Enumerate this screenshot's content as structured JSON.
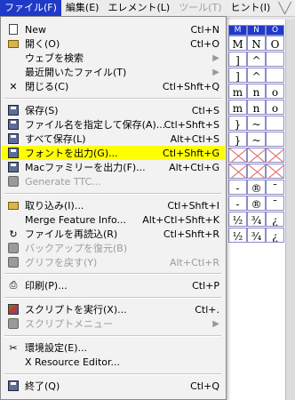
{
  "menubar": [
    {
      "label": "ファイル(F)",
      "active": true,
      "disabled": false
    },
    {
      "label": "編集(E)",
      "active": false,
      "disabled": false
    },
    {
      "label": "エレメント(L)",
      "active": false,
      "disabled": false
    },
    {
      "label": "ツール(T)",
      "active": false,
      "disabled": true
    },
    {
      "label": "ヒント(I)",
      "active": false,
      "disabled": false
    }
  ],
  "grid": {
    "headers": [
      "M",
      "N",
      "O"
    ],
    "rows": [
      [
        "M",
        "N",
        "O"
      ],
      [
        "]",
        "^",
        "_"
      ],
      [
        "]",
        "^",
        "_"
      ],
      [
        "m",
        "n",
        "o"
      ],
      [
        "m",
        "n",
        "o"
      ],
      [
        "}",
        "~",
        ""
      ],
      [
        "}",
        "~",
        ""
      ],
      [
        "",
        "",
        ""
      ],
      [
        "",
        "",
        ""
      ],
      [
        "-",
        "®",
        "¯"
      ],
      [
        "-",
        "®",
        "¯"
      ],
      [
        "½",
        "¾",
        "¿"
      ],
      [
        "½",
        "¾",
        "¿"
      ]
    ]
  },
  "menu": {
    "new": {
      "label": "New",
      "shortcut": "Ctl+N"
    },
    "open": {
      "label": "開く(O)",
      "shortcut": "Ctl+O"
    },
    "web": {
      "label": "ウェブを検索"
    },
    "recent": {
      "label": "最近開いたファイル(T)"
    },
    "close": {
      "label": "閉じる(C)",
      "shortcut": "Ctl+Shft+Q"
    },
    "save": {
      "label": "保存(S)",
      "shortcut": "Ctl+S"
    },
    "saveas": {
      "label": "ファイル名を指定して保存(A)...",
      "shortcut": "Ctl+Shft+S"
    },
    "saveall": {
      "label": "すべて保存(L)",
      "shortcut": "Alt+Ctl+S"
    },
    "generate": {
      "label": "フォントを出力(G)...",
      "shortcut": "Ctl+Shft+G"
    },
    "genmac": {
      "label": "Macファミリーを出力(F)...",
      "shortcut": "Alt+Ctl+G"
    },
    "genttc": {
      "label": "Generate TTC..."
    },
    "import": {
      "label": "取り込み(I)...",
      "shortcut": "Ctl+Shft+I"
    },
    "merge": {
      "label": "Merge Feature Info...",
      "shortcut": "Alt+Ctl+Shft+K"
    },
    "revert": {
      "label": "ファイルを再読込(R)",
      "shortcut": "Ctl+Shft+R"
    },
    "backup": {
      "label": "バックアップを復元(B)"
    },
    "revertglyph": {
      "label": "グリフを戻す(Y)",
      "shortcut": "Alt+Ctl+R"
    },
    "print": {
      "label": "印刷(P)...",
      "shortcut": "Ctl+P"
    },
    "script": {
      "label": "スクリプトを実行(X)...",
      "shortcut": "Ctl+."
    },
    "scriptmenu": {
      "label": "スクリプトメニュー"
    },
    "prefs": {
      "label": "環境設定(E)..."
    },
    "xres": {
      "label": "X Resource Editor..."
    },
    "quit": {
      "label": "終了(Q)",
      "shortcut": "Ctl+Q"
    }
  }
}
